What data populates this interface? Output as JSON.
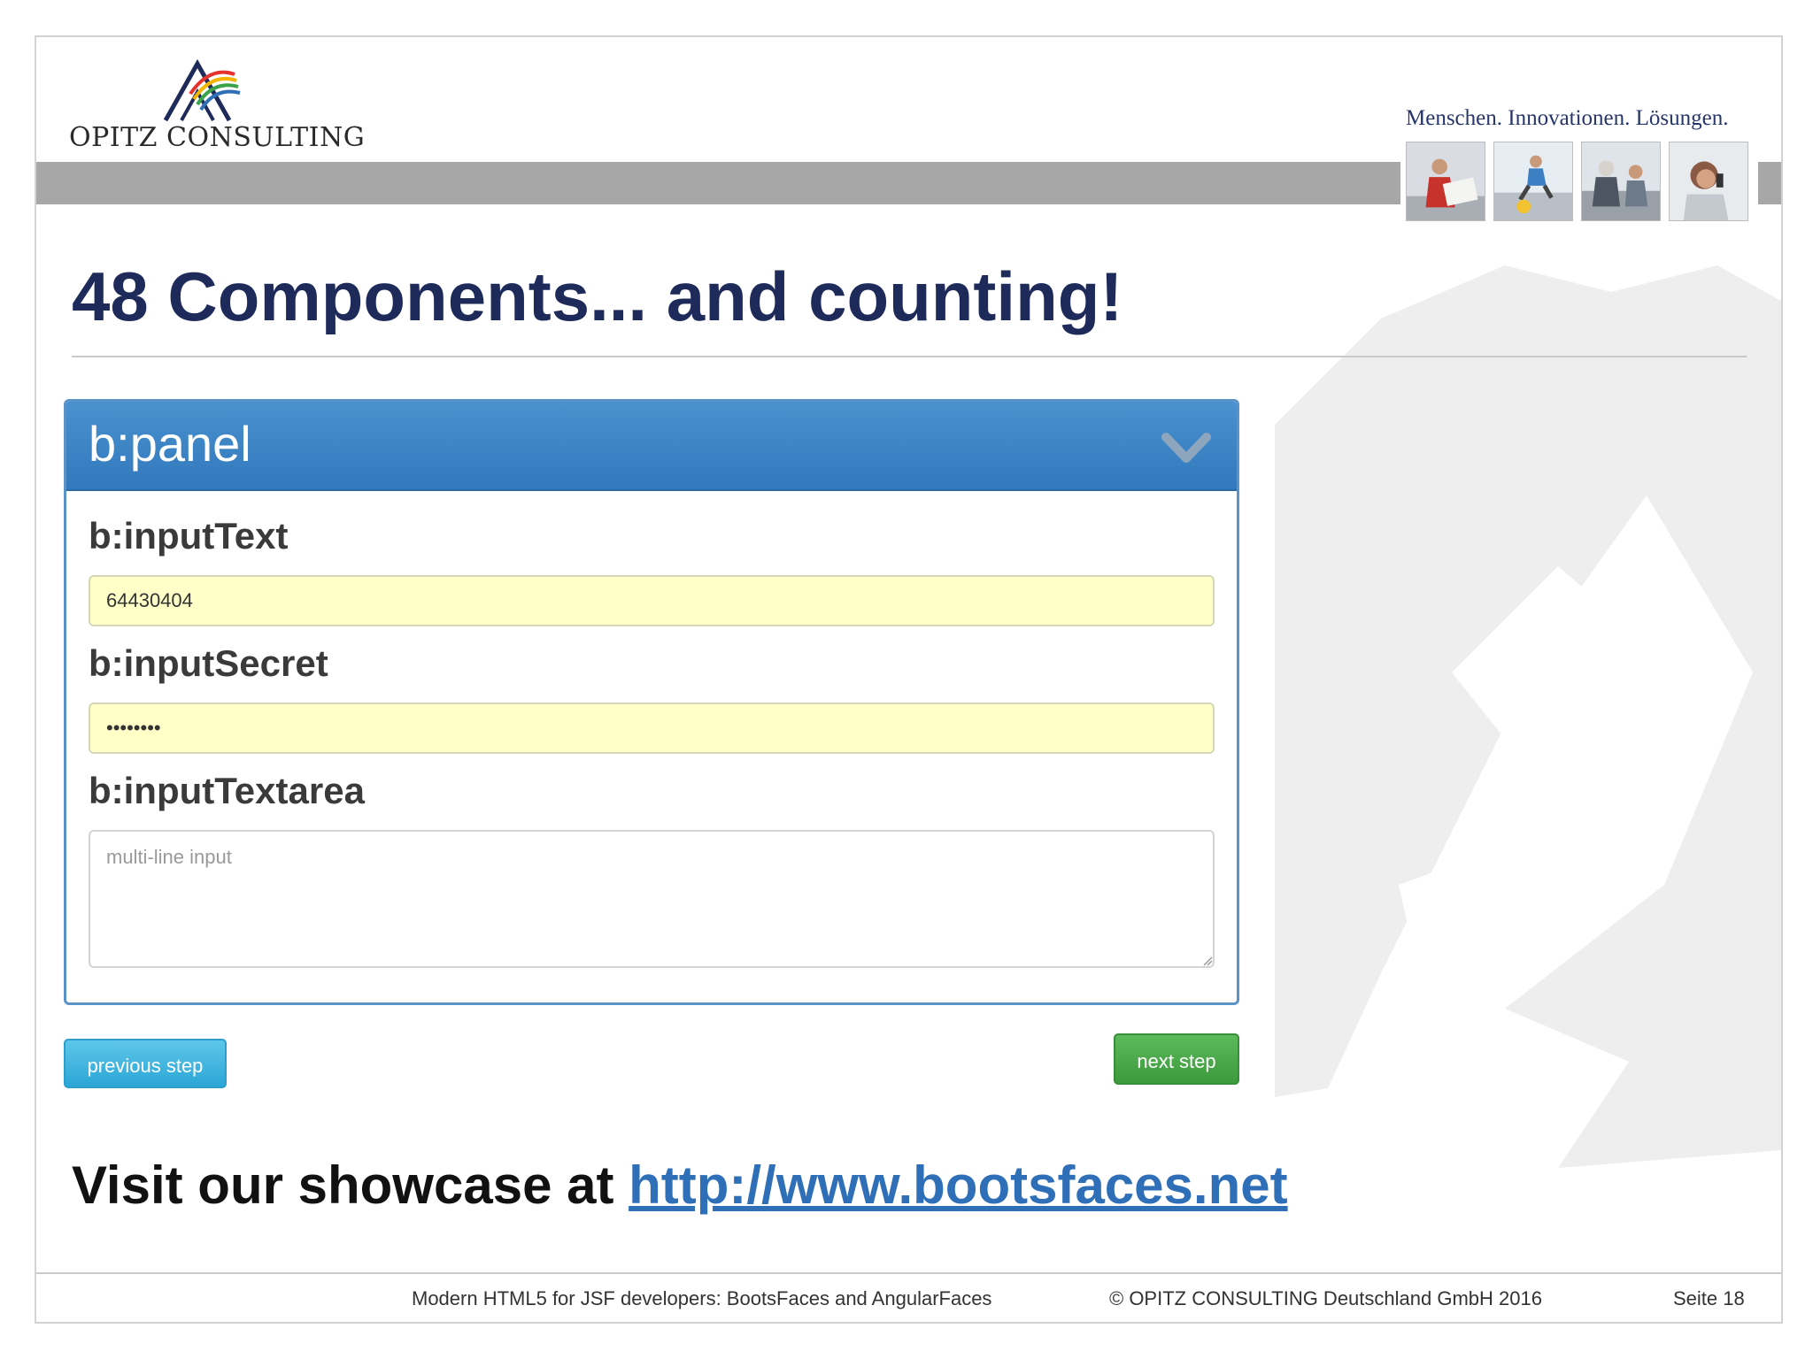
{
  "header": {
    "logo_text": "OPITZ CONSULTING",
    "tagline": "Menschen. Innovationen. Lösungen.",
    "photos": [
      "photo-person-with-map",
      "photo-child-jumping",
      "photo-grandparents-child",
      "photo-person-on-phone"
    ]
  },
  "slide": {
    "title": "48 Components... and counting!"
  },
  "panel": {
    "title": "b:panel",
    "input_text_label": "b:inputText",
    "input_text_value": "64430404",
    "input_secret_label": "b:inputSecret",
    "input_secret_value": "••••••••",
    "textarea_label": "b:inputTextarea",
    "textarea_placeholder": "multi-line input"
  },
  "buttons": {
    "previous_label": "previous step",
    "next_label": "next step"
  },
  "showcase": {
    "prefix": "Visit our showcase at ",
    "link_text": "http://www.bootsfaces.net"
  },
  "footer": {
    "presentation_title": "Modern HTML5 for JSF developers: BootsFaces and AngularFaces",
    "copyright": "© OPITZ CONSULTING Deutschland GmbH 2016",
    "page": "Seite 18"
  },
  "colors": {
    "title": "#1e2a5a",
    "panel_header": "#3a85c6",
    "input_highlight": "#ffffc8",
    "prev_button": "#3fb5e0",
    "next_button": "#4cab4c",
    "link": "#2f6fb8"
  }
}
